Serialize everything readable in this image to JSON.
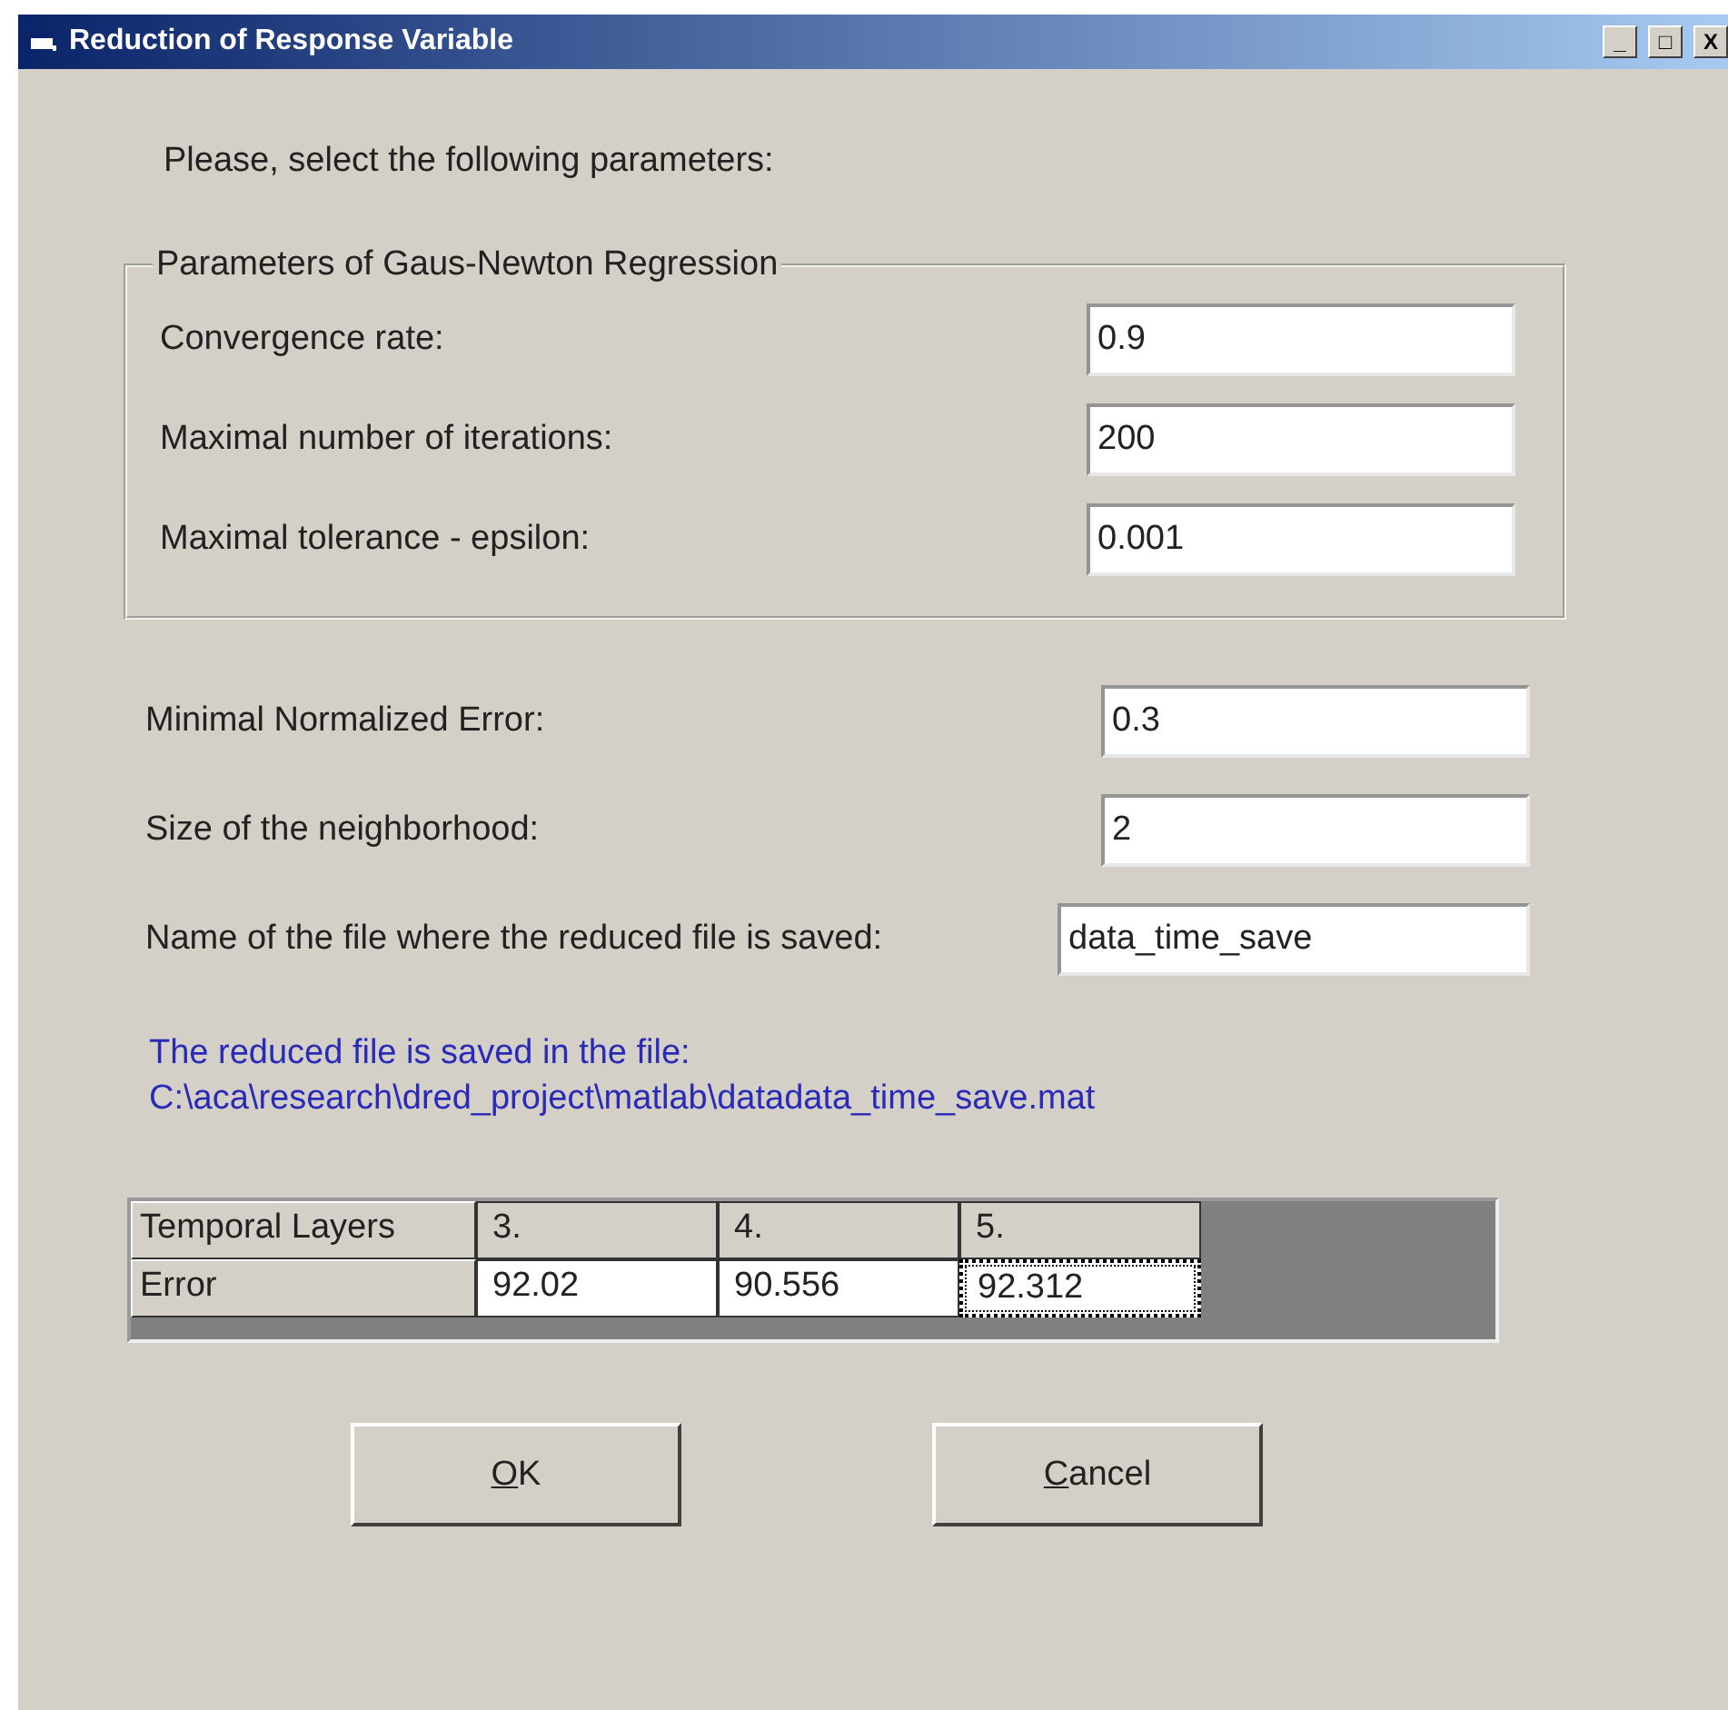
{
  "window": {
    "title": "Reduction of Response Variable",
    "controls": [
      "_",
      "□",
      "X"
    ]
  },
  "prompt": "Please, select the following parameters:",
  "group": {
    "title": "Parameters of Gaus-Newton Regression",
    "fields": [
      {
        "label": "Convergence rate:",
        "value": "0.9"
      },
      {
        "label": "Maximal number of iterations:",
        "value": "200"
      },
      {
        "label": "Maximal tolerance - epsilon:",
        "value": "0.001"
      }
    ]
  },
  "fields": [
    {
      "label": "Minimal Normalized Error:",
      "value": "0.3"
    },
    {
      "label": "Size of the neighborhood:",
      "value": "2"
    },
    {
      "label": "Name of the file where the reduced file is saved:",
      "value": "data_time_save"
    }
  ],
  "info": [
    "The reduced file is saved in the file:",
    "C:\\aca\\research\\dred_project\\matlab\\datadata_time_save.mat"
  ],
  "table": {
    "rows": [
      {
        "header": "Temporal Layers",
        "cells": [
          {
            "text": "3.",
            "focused": false
          },
          {
            "text": "4.",
            "focused": false
          },
          {
            "text": "5.",
            "focused": false
          }
        ]
      },
      {
        "header": "Error",
        "cells": [
          {
            "text": "92.02",
            "focused": false
          },
          {
            "text": "90.556",
            "focused": false
          },
          {
            "text": "92.312",
            "focused": true
          }
        ]
      }
    ]
  },
  "buttons": [
    "OK",
    "Cancel"
  ]
}
